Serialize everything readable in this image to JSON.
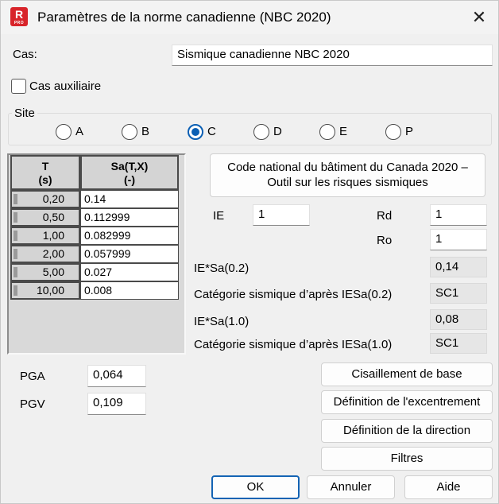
{
  "window": {
    "title": "Paramètres de la norme canadienne (NBC 2020)",
    "app_icon_letter": "R",
    "app_icon_sub": "PRO",
    "close_glyph": "✕"
  },
  "cas": {
    "label": "Cas:",
    "value": "Sismique canadienne NBC 2020"
  },
  "auxiliary": {
    "label": "Cas auxiliaire",
    "checked": false
  },
  "site": {
    "legend": "Site",
    "options": [
      "A",
      "B",
      "C",
      "D",
      "E",
      "P"
    ],
    "selected": "C"
  },
  "table": {
    "col1_header": [
      "T",
      "(s)"
    ],
    "col2_header": [
      "Sa(T,X)",
      "(-)"
    ],
    "rows": [
      {
        "t": "0,20",
        "sa": "0.14"
      },
      {
        "t": "0,50",
        "sa": "0.112999"
      },
      {
        "t": "1,00",
        "sa": "0.082999"
      },
      {
        "t": "2,00",
        "sa": "0.057999"
      },
      {
        "t": "5,00",
        "sa": "0.027"
      },
      {
        "t": "10,00",
        "sa": "0.008"
      }
    ]
  },
  "code_button": {
    "line1": "Code national du bâtiment du Canada 2020 –",
    "line2": "Outil sur les risques sismiques"
  },
  "params": {
    "ie_label": "IE",
    "ie_value": "1",
    "rd_label": "Rd",
    "rd_value": "1",
    "ro_label": "Ro",
    "ro_value": "1",
    "iesa02_label": "IE*Sa(0.2)",
    "iesa02_value": "0,14",
    "cat02_label": "Catégorie sismique d’après IESa(0.2)",
    "cat02_value": "SC1",
    "iesa10_label": "IE*Sa(1.0)",
    "iesa10_value": "0,08",
    "cat10_label": "Catégorie sismique d’après IESa(1.0)",
    "cat10_value": "SC1"
  },
  "pga": {
    "label": "PGA",
    "value": "0,064"
  },
  "pgv": {
    "label": "PGV",
    "value": "0,109"
  },
  "buttons": {
    "base_shear": "Cisaillement de base",
    "eccentricity": "Définition de l'excentrement",
    "direction": "Définition de la direction",
    "filters": "Filtres",
    "ok": "OK",
    "cancel": "Annuler",
    "help": "Aide"
  }
}
